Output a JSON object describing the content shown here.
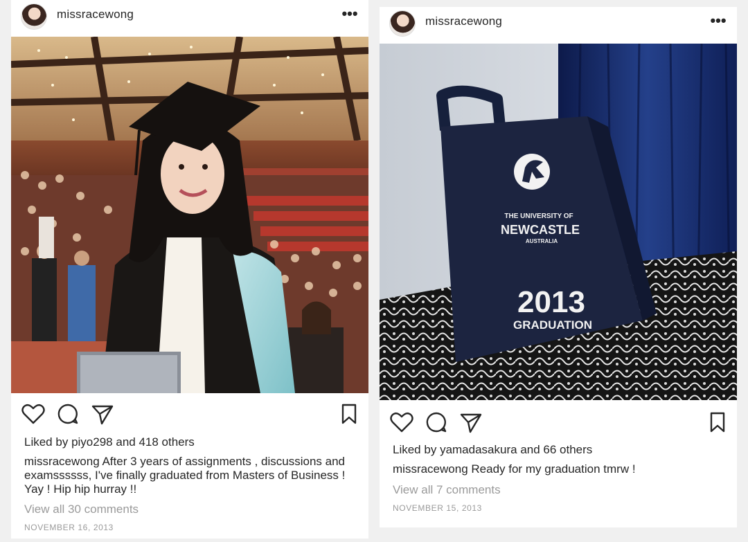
{
  "posts": [
    {
      "username": "missracewong",
      "more_icon": "more-horizontal-icon",
      "liked_prefix": "Liked by",
      "liked_user": "piyo298",
      "liked_suffix": "and 418 others",
      "caption_user": "missracewong",
      "caption_text": "After 3 years of assignments , discussions and examssssss, I've finally graduated from Masters of Business ! Yay ! Hip hip hurray !!",
      "view_comments": "View all 30 comments",
      "date": "NOVEMBER 16, 2013",
      "icons": [
        "heart-icon",
        "comment-icon",
        "share-icon",
        "bookmark-icon"
      ]
    },
    {
      "username": "missracewong",
      "more_icon": "more-horizontal-icon",
      "liked_prefix": "Liked by",
      "liked_user": "yamadasakura",
      "liked_suffix": "and 66 others",
      "caption_user": "missracewong",
      "caption_text": "Ready for my graduation tmrw !",
      "view_comments": "View all 7 comments",
      "date": "NOVEMBER 15, 2013",
      "icons": [
        "heart-icon",
        "comment-icon",
        "share-icon",
        "bookmark-icon"
      ],
      "bag_print": {
        "line1": "THE UNIVERSITY OF",
        "line2": "NEWCASTLE",
        "line3": "AUSTRALIA",
        "year": "2013",
        "label": "GRADUATION"
      }
    }
  ],
  "colors": {
    "text": "#262626",
    "muted": "#9a9a9a",
    "background": "#f0f0f0",
    "bag": "#1c2440"
  }
}
